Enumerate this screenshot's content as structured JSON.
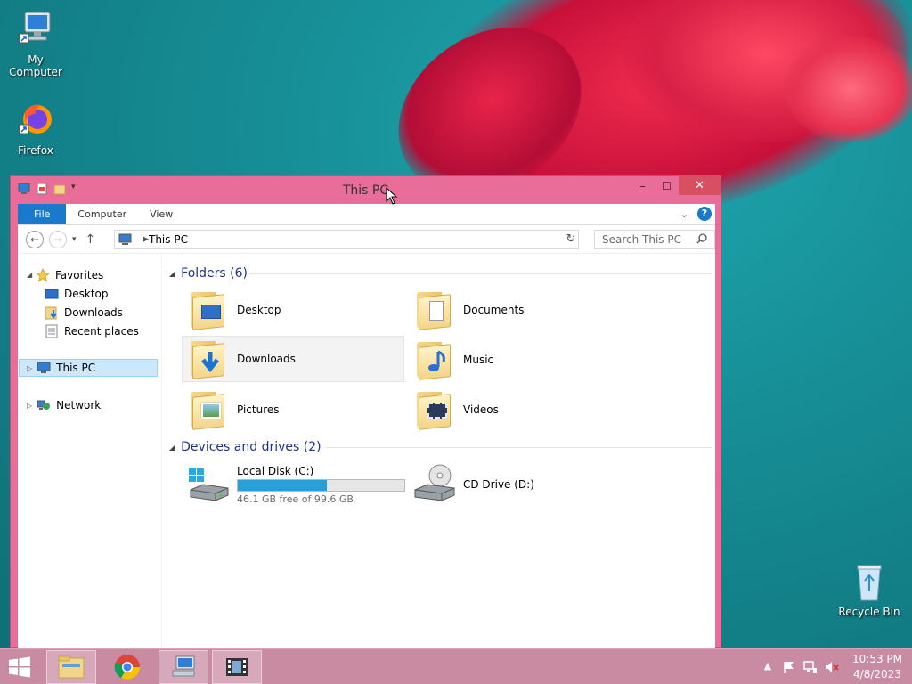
{
  "desktop": {
    "icons": [
      {
        "label": "My Computer"
      },
      {
        "label": "Firefox"
      },
      {
        "label": "Recycle Bin"
      }
    ]
  },
  "window": {
    "title": "This PC",
    "controls": {
      "minimize": "–",
      "maximize": "☐",
      "close": "✕"
    },
    "ribbon_tabs": [
      "File",
      "Computer",
      "View"
    ],
    "help_label": "?",
    "address": {
      "path": "This PC"
    },
    "search": {
      "placeholder": "Search This PC"
    },
    "nav_pane": {
      "favorites": "Favorites",
      "favorites_items": [
        "Desktop",
        "Downloads",
        "Recent places"
      ],
      "this_pc": "This PC",
      "network": "Network"
    },
    "folders_group": {
      "header": "Folders (6)",
      "items": [
        "Desktop",
        "Documents",
        "Downloads",
        "Music",
        "Pictures",
        "Videos"
      ]
    },
    "drives_group": {
      "header": "Devices and drives (2)",
      "drives": [
        {
          "name": "Local Disk (C:)",
          "free_text": "46.1 GB free of 99.6 GB",
          "used_fraction": 0.537
        },
        {
          "name": "CD Drive (D:)"
        }
      ]
    }
  },
  "taskbar": {
    "clock": {
      "time": "10:53 PM",
      "date": "4/8/2023"
    }
  },
  "colors": {
    "window_frame": "#e86d98",
    "taskbar": "#c98ba2",
    "file_tab": "#1979ca",
    "drive_bar": "#26a0da"
  }
}
